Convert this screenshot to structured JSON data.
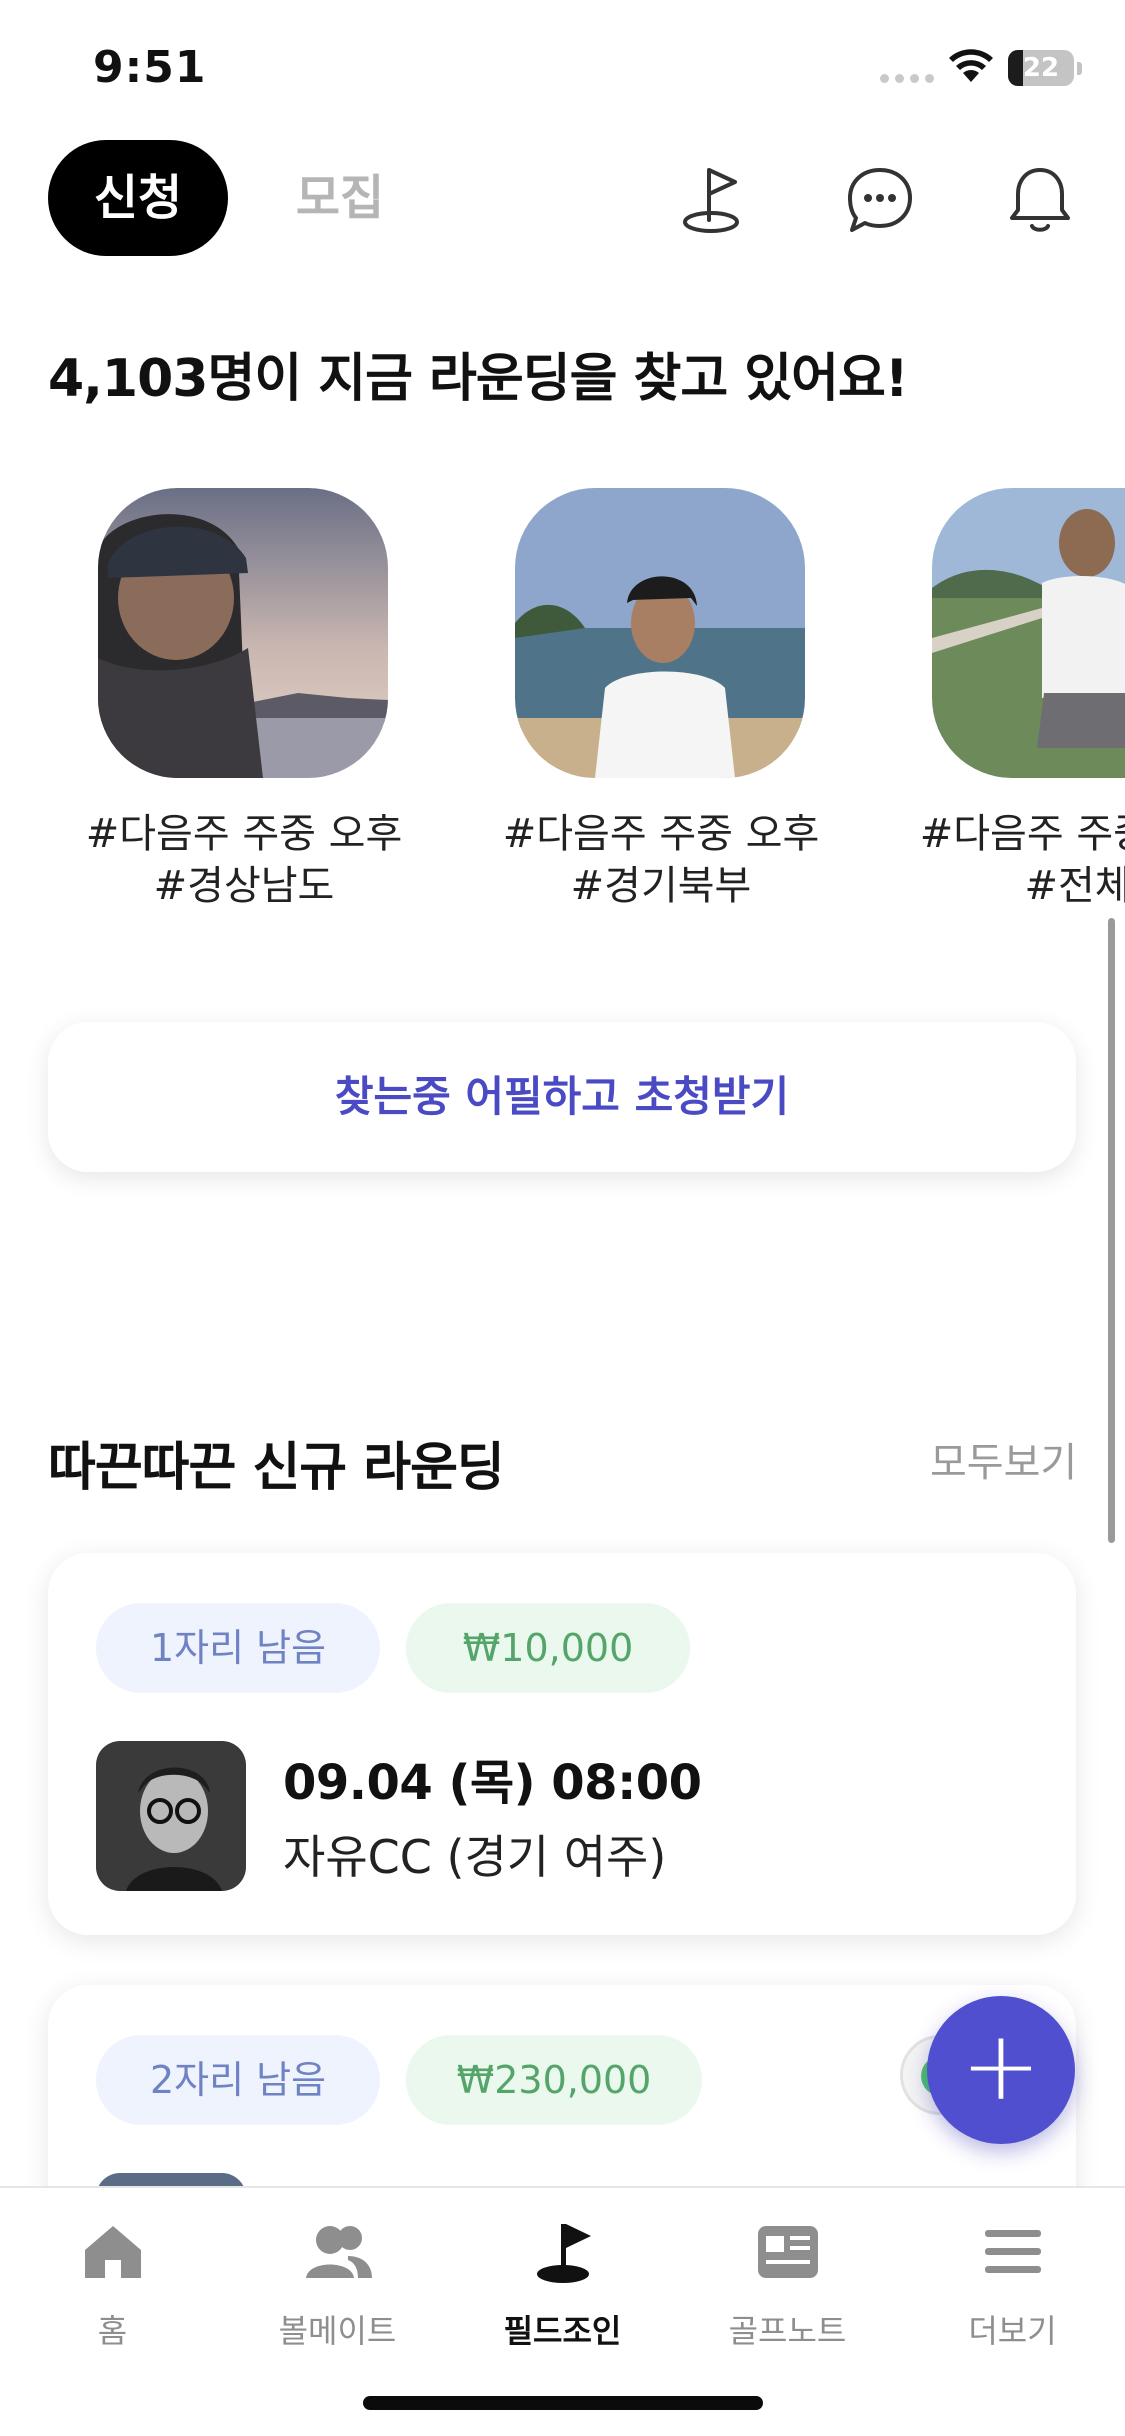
{
  "status": {
    "time": "9:51",
    "battery": "22",
    "battery_level": 0.22
  },
  "header": {
    "tab_active": "신청",
    "tab_inactive": "모집",
    "icons": [
      "flag-icon",
      "chat-icon",
      "bell-icon"
    ]
  },
  "headline": "4,103명이 지금 라운딩을 찾고 있어요!",
  "profiles": [
    {
      "tag1": "#다음주 주중 오후",
      "tag2": "#경상남도"
    },
    {
      "tag1": "#다음주 주중 오후",
      "tag2": "#경기북부"
    },
    {
      "tag1": "#다음주 주중 오후",
      "tag2": "#전체"
    }
  ],
  "appeal_button": "찾는중 어필하고 초청받기",
  "section": {
    "title": "따끈따끈 신규 라운딩",
    "see_all": "모두보기"
  },
  "rounds": [
    {
      "seats": "1자리 남음",
      "fee": "₩10,000",
      "datetime": "09.04 (목) 08:00",
      "course": "자유CC (경기 여주)"
    },
    {
      "seats": "2자리 남음",
      "fee": "₩230,000"
    }
  ],
  "fab": "+",
  "nav": [
    {
      "label": "홈",
      "icon": "home-icon"
    },
    {
      "label": "볼메이트",
      "icon": "people-icon"
    },
    {
      "label": "필드조인",
      "icon": "golf-flag-icon",
      "active": true
    },
    {
      "label": "골프노트",
      "icon": "note-icon"
    },
    {
      "label": "더보기",
      "icon": "menu-icon"
    }
  ],
  "colors": {
    "accent": "#4f4fcf",
    "appeal_text": "#4a4bc4",
    "seat_pill_bg": "#eef3fd",
    "fee_pill_bg": "#eaf8ee"
  }
}
